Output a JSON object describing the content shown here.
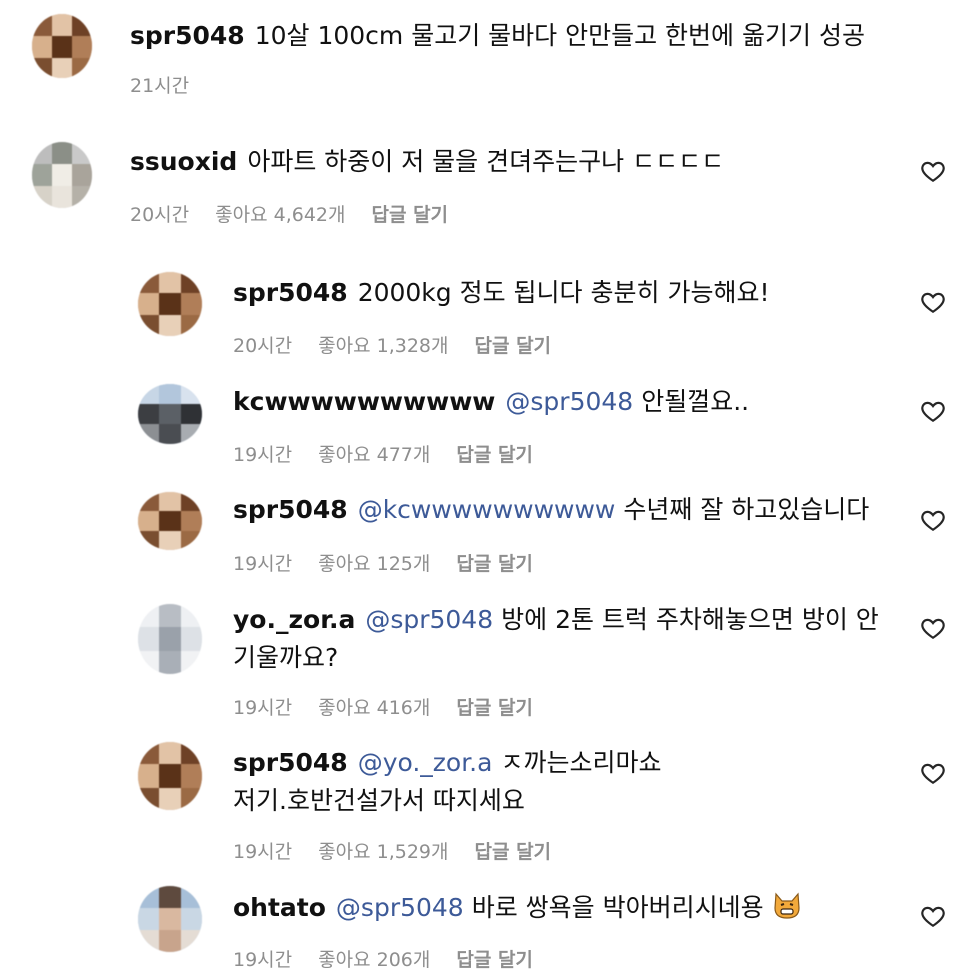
{
  "comments": [
    {
      "username": "spr5048",
      "mention": "",
      "lines": [
        "10살 100cm 물고기 물바다 안만들고 한번에 옮기기 성공"
      ],
      "time": "21시간",
      "likes": "",
      "reply": ""
    },
    {
      "username": "ssuoxid",
      "mention": "",
      "lines": [
        "아파트 하중이 저 물을 견뎌주는구나 ㄷㄷㄷㄷ"
      ],
      "time": "20시간",
      "likes": "좋아요 4,642개",
      "reply": "답글 달기"
    },
    {
      "username": "spr5048",
      "mention": "",
      "lines": [
        "2000kg 정도 됩니다 충분히 가능해요!"
      ],
      "time": "20시간",
      "likes": "좋아요 1,328개",
      "reply": "답글 달기"
    },
    {
      "username": "kcwwwwwwwwww",
      "mention": "@spr5048",
      "lines": [
        "안될껄요.."
      ],
      "time": "19시간",
      "likes": "좋아요 477개",
      "reply": "답글 달기"
    },
    {
      "username": "spr5048",
      "mention": "@kcwwwwwwwwww",
      "lines": [
        "수년째 잘 하고있습니다"
      ],
      "time": "19시간",
      "likes": "좋아요 125개",
      "reply": "답글 달기"
    },
    {
      "username": "yo._zor.a",
      "mention": "@spr5048",
      "lines": [
        "방에 2톤 트럭 주차해놓으면 방이 안",
        "기울까요?"
      ],
      "time": "19시간",
      "likes": "좋아요 416개",
      "reply": "답글 달기"
    },
    {
      "username": "spr5048",
      "mention": "@yo._zor.a",
      "lines": [
        "ㅈ까는소리마쇼",
        "저기.호반건설가서 따지세요"
      ],
      "time": "19시간",
      "likes": "좋아요 1,529개",
      "reply": "답글 달기"
    },
    {
      "username": "ohtato",
      "mention": "@spr5048",
      "lines": [
        "바로 쌍욕을 박아버리시네용"
      ],
      "time": "19시간",
      "likes": "좋아요 206개",
      "reply": "답글 달기"
    }
  ],
  "icons": {
    "like": "heart-outline-icon",
    "emoji": "cat-emoji-icon"
  },
  "colors": {
    "mention": "#3d5a98",
    "meta": "#8e8e8e",
    "text": "#111111"
  }
}
